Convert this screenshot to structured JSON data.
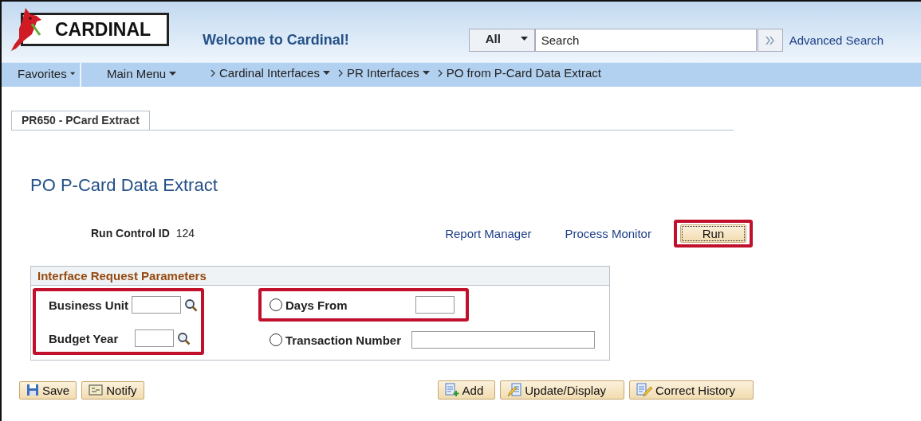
{
  "header": {
    "logo": "CARDINAL",
    "welcome": "Welcome to Cardinal!",
    "search_scope": "All",
    "search": {
      "placeholder": "Search"
    },
    "advanced_search": "Advanced Search"
  },
  "nav": {
    "favorites": "Favorites",
    "main_menu": "Main Menu",
    "breadcrumbs": [
      {
        "label": "Cardinal Interfaces",
        "dropdown": true
      },
      {
        "label": "PR Interfaces",
        "dropdown": true
      },
      {
        "label": "PO from P-Card Data Extract",
        "dropdown": false
      }
    ]
  },
  "tabs": [
    {
      "label": "PR650 - PCard Extract",
      "selected": true
    }
  ],
  "page_title": "PO P-Card Data Extract",
  "run_control": {
    "label": "Run Control ID",
    "value": "124"
  },
  "links": [
    "Report Manager",
    "Process Monitor"
  ],
  "run_button": {
    "label": "Run",
    "highlighted": true
  },
  "group": {
    "title": "Interface Request Parameters",
    "left": {
      "highlighted": true,
      "fields": [
        {
          "label": "Business Unit"
        },
        {
          "label": "Budget Year"
        }
      ]
    },
    "options": [
      {
        "label": "Days From",
        "selected": false,
        "highlighted": true
      },
      {
        "label": "Transaction Number",
        "selected": false,
        "highlighted": false
      }
    ]
  },
  "toolbar_left": [
    {
      "label": "Save",
      "kind": "save"
    },
    {
      "label": "Notify",
      "kind": "notify"
    }
  ],
  "toolbar_right": [
    {
      "label": "Add",
      "kind": "add"
    },
    {
      "label": "Update/Display",
      "kind": "update"
    },
    {
      "label": "Correct History",
      "kind": "history"
    }
  ]
}
